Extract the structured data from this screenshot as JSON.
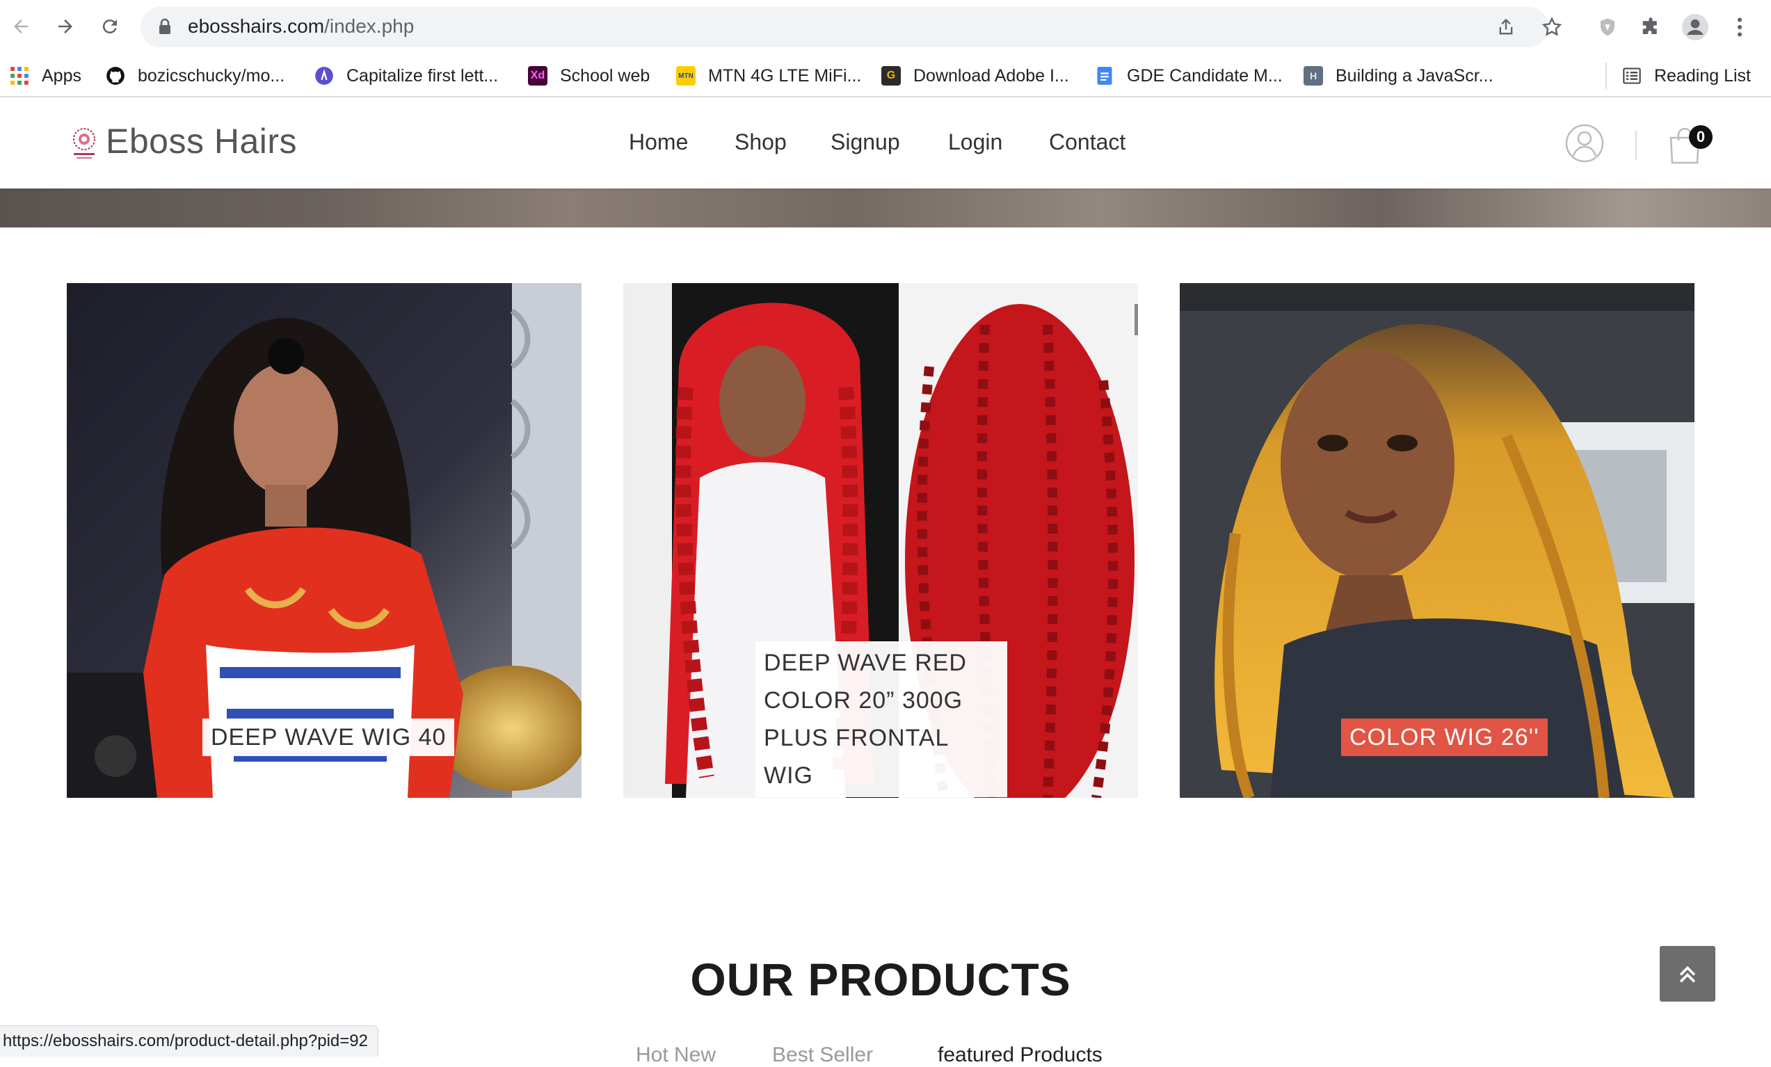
{
  "browser": {
    "url_domain": "ebosshairs.com",
    "url_path": "/index.php",
    "bookmarks": [
      {
        "label": "Apps",
        "icon": "apps-grid-icon",
        "color": "#ea4335"
      },
      {
        "label": "bozicschucky/mo...",
        "icon": "github-icon",
        "color": "#111111"
      },
      {
        "label": "Capitalize first lett...",
        "icon": "codepen-icon",
        "color": "#5a4fcf"
      },
      {
        "label": "School web",
        "icon": "adobe-xd-icon",
        "color": "#470137"
      },
      {
        "label": "MTN 4G LTE MiFi...",
        "icon": "mtn-icon",
        "color": "#ffcc00"
      },
      {
        "label": "Download Adobe I...",
        "icon": "g-icon",
        "color": "#2b2b2b"
      },
      {
        "label": "GDE Candidate M...",
        "icon": "google-docs-icon",
        "color": "#4285f4"
      },
      {
        "label": "Building a JavaScr...",
        "icon": "hashnode-icon",
        "color": "#607080"
      }
    ],
    "reading_list": "Reading List",
    "status_url": "https://ebosshairs.com/product-detail.php?pid=92"
  },
  "site": {
    "brand": "Eboss Hairs",
    "menu": [
      "Home",
      "Shop",
      "Signup",
      "Login",
      "Contact"
    ],
    "cart_count": "0"
  },
  "banners": [
    {
      "label": "DEEP WAVE WIG 40",
      "highlighted": false
    },
    {
      "label_lines": [
        "DEEP WAVE RED",
        "COLOR 20” 300G",
        "PLUS FRONTAL WIG"
      ],
      "highlighted": false
    },
    {
      "label": "COLOR WIG 26''",
      "highlighted": true,
      "highlight_color": "#e25443"
    }
  ],
  "products": {
    "title": "OUR PRODUCTS",
    "tabs": [
      "Hot New",
      "Best Seller",
      "featured Products"
    ]
  }
}
